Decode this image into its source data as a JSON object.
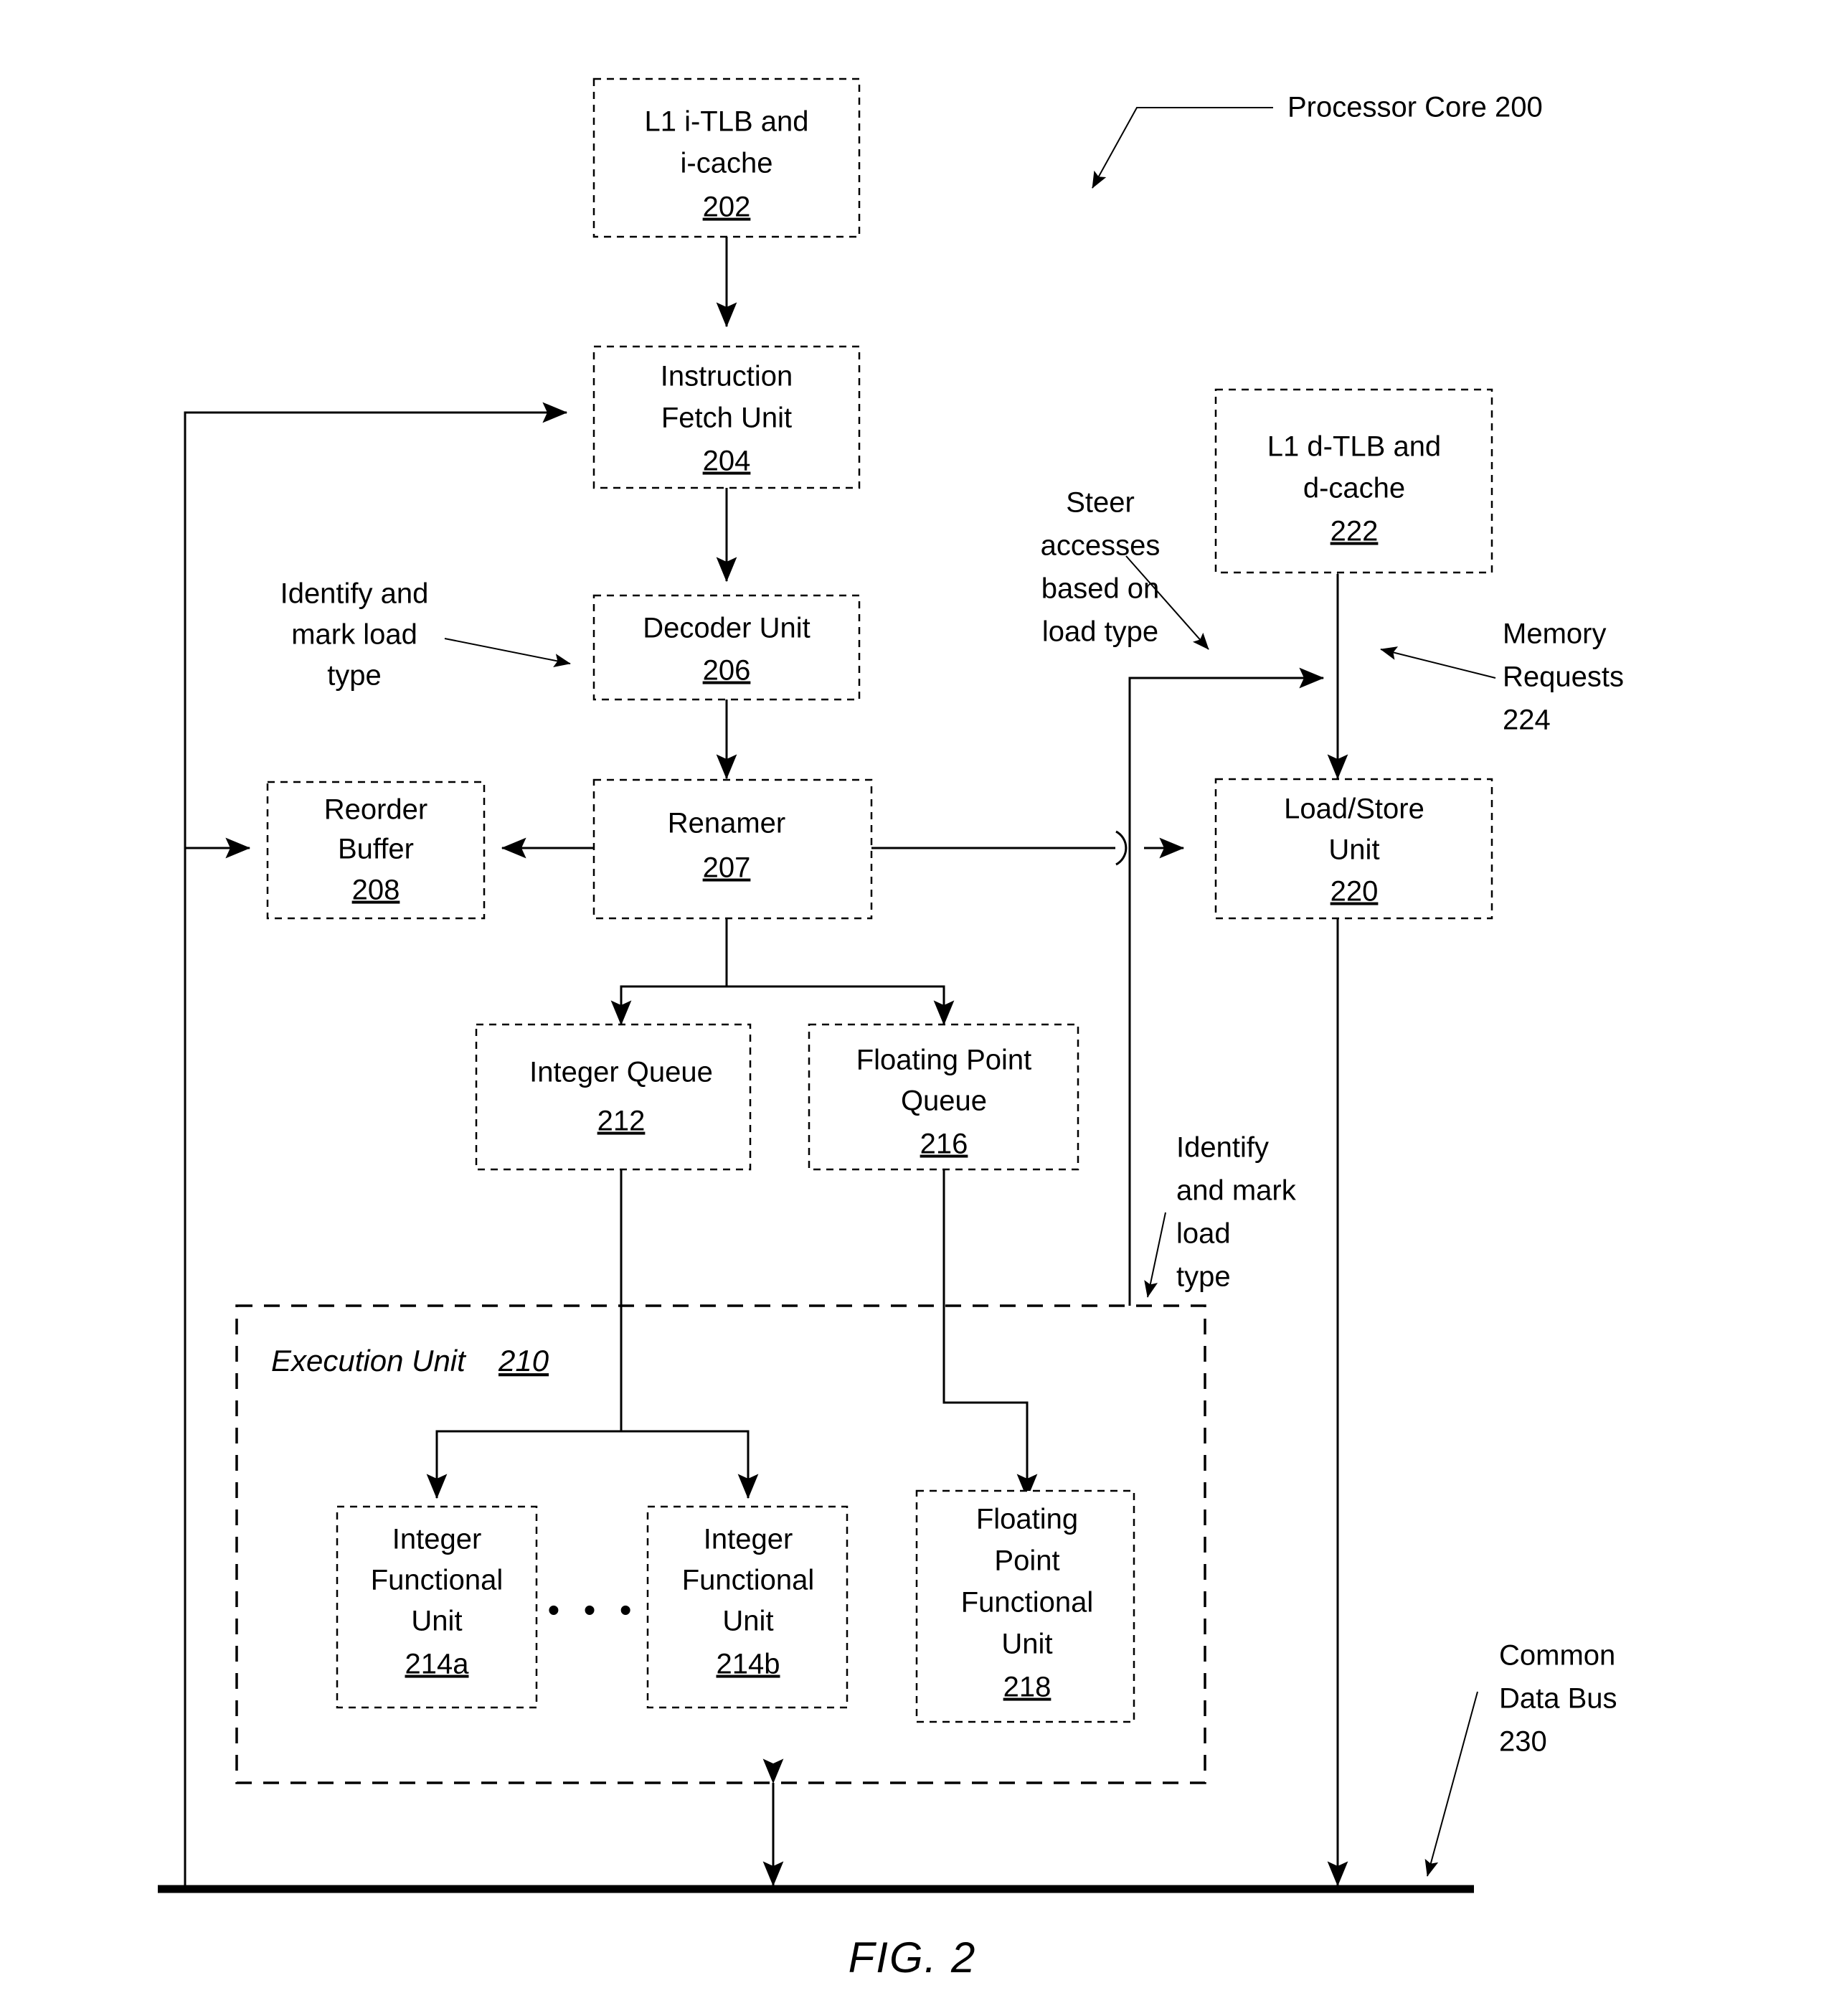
{
  "figure": {
    "caption": "FIG. 2",
    "title_callout": "Processor Core 200"
  },
  "blocks": {
    "l1_itlb": {
      "line1": "L1 i-TLB and",
      "line2": "i-cache",
      "ref": "202"
    },
    "ifu": {
      "line1": "Instruction",
      "line2": "Fetch Unit",
      "ref": "204"
    },
    "decoder": {
      "line1": "Decoder Unit",
      "ref": "206"
    },
    "renamer": {
      "line1": "Renamer",
      "ref": "207"
    },
    "reorder_buffer": {
      "line1": "Reorder",
      "line2": "Buffer",
      "ref": "208"
    },
    "integer_queue": {
      "line1": "Integer Queue",
      "ref": "212"
    },
    "fp_queue": {
      "line1": "Floating Point",
      "line2": "Queue",
      "ref": "216"
    },
    "l1_dtlb": {
      "line1": "L1 d-TLB and",
      "line2": "d-cache",
      "ref": "222"
    },
    "lsu": {
      "line1": "Load/Store",
      "line2": "Unit",
      "ref": "220"
    },
    "execution_unit": {
      "title": "Execution Unit",
      "ref": "210"
    },
    "ifu_a": {
      "line1": "Integer",
      "line2": "Functional",
      "line3": "Unit",
      "ref": "214a"
    },
    "ifu_b": {
      "line1": "Integer",
      "line2": "Functional",
      "line3": "Unit",
      "ref": "214b"
    },
    "fpfu": {
      "line1": "Floating",
      "line2": "Point",
      "line3": "Functional",
      "line4": "Unit",
      "ref": "218"
    },
    "ellipsis": "•  •  •"
  },
  "annotations": {
    "identify_mark_left": {
      "line1": "Identify and",
      "line2": "mark load",
      "line3": "type"
    },
    "steer_accesses": {
      "line1": "Steer",
      "line2": "accesses",
      "line3": "based on",
      "line4": "load type"
    },
    "memory_requests": {
      "line1": "Memory",
      "line2": "Requests",
      "line3": "224"
    },
    "identify_mark_right": {
      "line1": "Identify",
      "line2": "and mark",
      "line3": "load",
      "line4": "type"
    },
    "common_data_bus": {
      "line1": "Common",
      "line2": "Data Bus",
      "line3": "230"
    }
  },
  "colors": {
    "ink": "#000000",
    "paper": "#ffffff"
  }
}
